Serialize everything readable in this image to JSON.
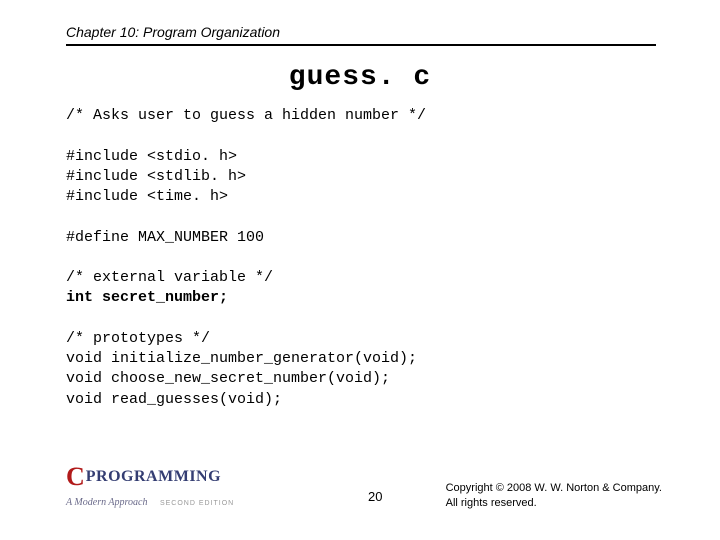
{
  "chapter": "Chapter 10: Program Organization",
  "title": "guess. c",
  "code": {
    "l1": "/* Asks user to guess a hidden number */",
    "l2": "#include <stdio. h>",
    "l3": "#include <stdlib. h>",
    "l4": "#include <time. h>",
    "l5": "#define MAX_NUMBER 100",
    "l6": "/* external variable */",
    "l7": "int secret_number;",
    "l8": "/* prototypes */",
    "l9": "void initialize_number_generator(void);",
    "l10": "void choose_new_secret_number(void);",
    "l11": "void read_guesses(void);"
  },
  "logo": {
    "c": "C",
    "prog": "PROGRAMMING",
    "sub": "A Modern Approach",
    "ed": "SECOND EDITION"
  },
  "pagenum": "20",
  "copyright": {
    "l1": "Copyright © 2008 W. W. Norton & Company.",
    "l2": "All rights reserved."
  }
}
